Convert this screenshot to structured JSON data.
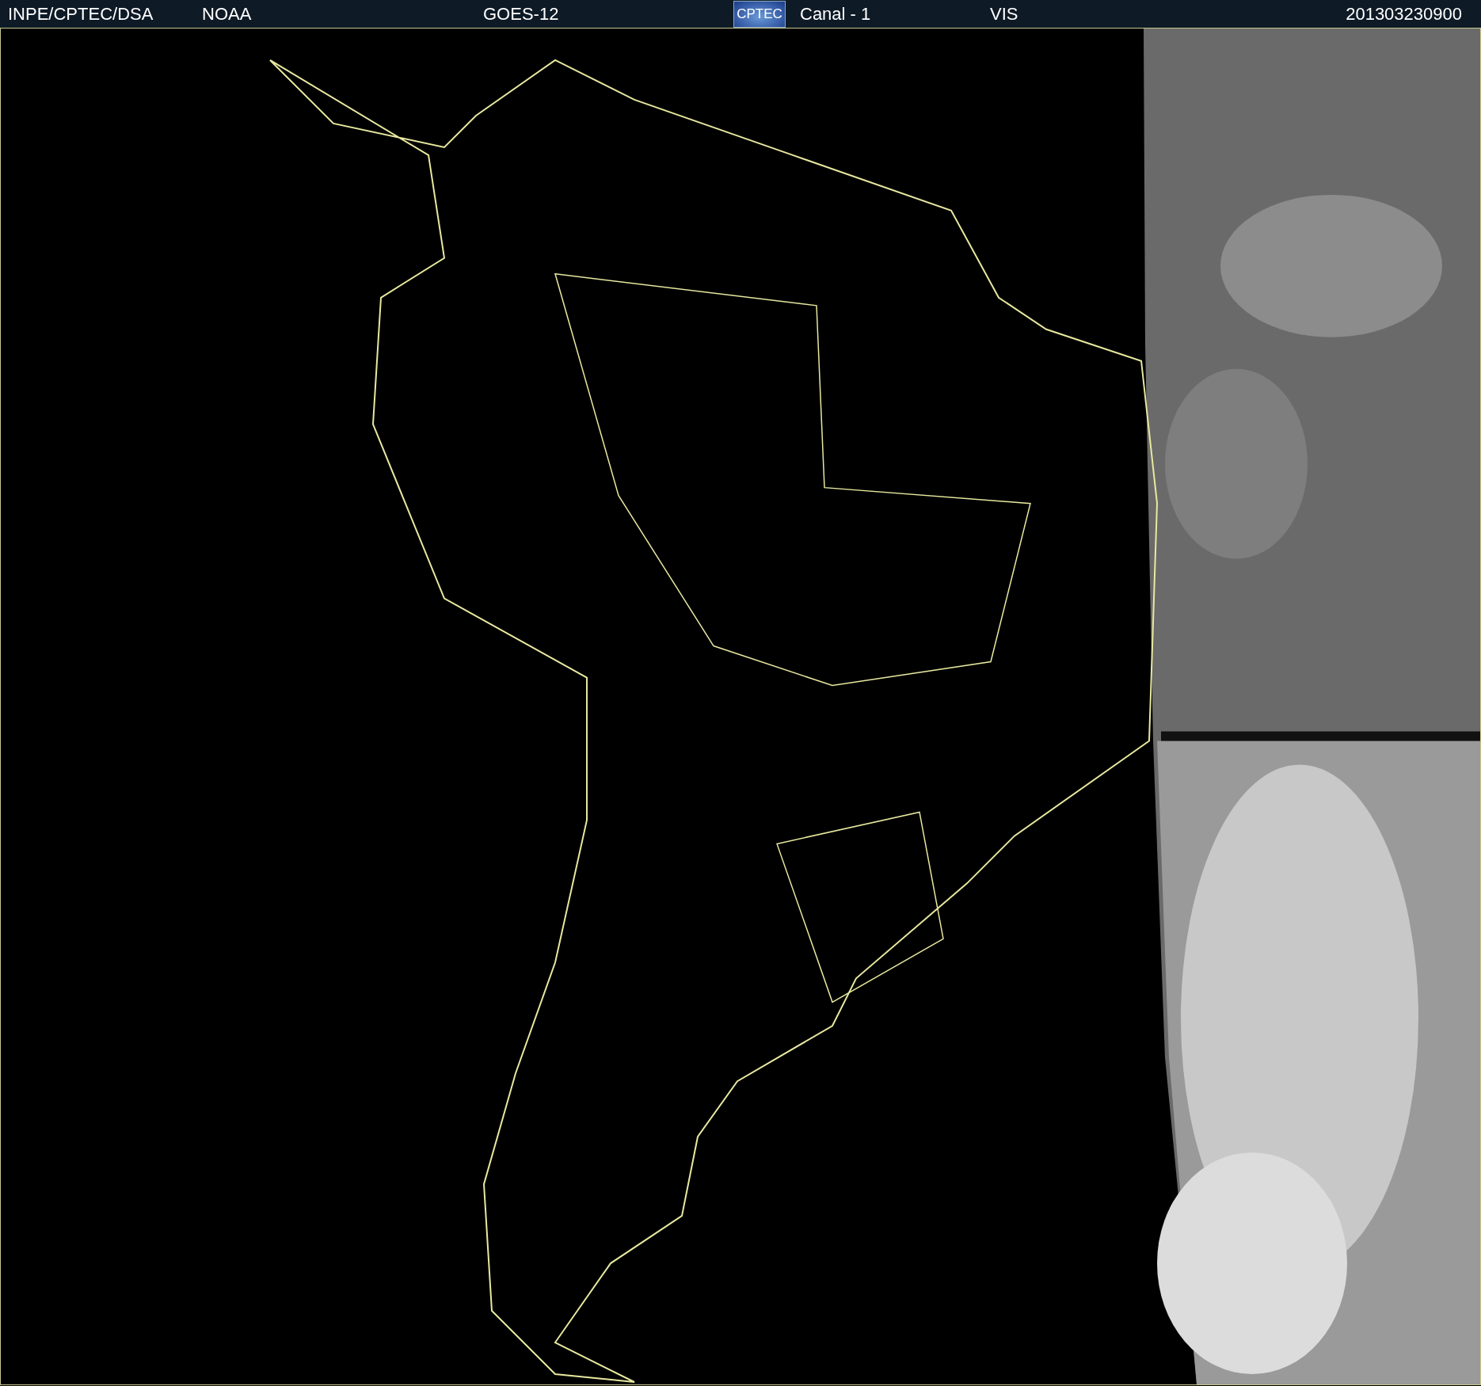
{
  "header": {
    "items": [
      {
        "kind": "text",
        "text": "INPE/CPTEC/DSA"
      },
      {
        "kind": "text",
        "text": "NOAA"
      },
      {
        "kind": "text",
        "text": "GOES-12"
      },
      {
        "kind": "logo",
        "text": "CPTEC"
      },
      {
        "kind": "text",
        "text": "Canal - 1"
      },
      {
        "kind": "text",
        "text": "VIS"
      },
      {
        "kind": "text",
        "text": "201303230900"
      }
    ]
  }
}
